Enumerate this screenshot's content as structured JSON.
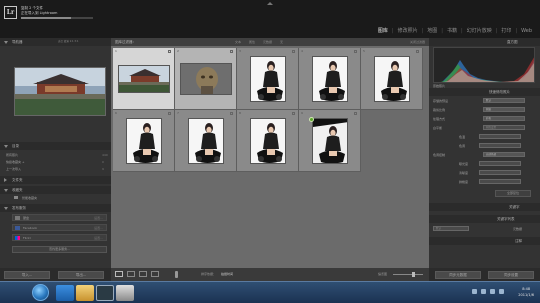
{
  "identity_plate": {
    "line1": "复制 2 个文件",
    "line2": "正在导入到 Lightroom",
    "logo": "Lr"
  },
  "import_progress": 0.7,
  "modules": [
    {
      "label": "图库",
      "active": true
    },
    {
      "label": "修改照片",
      "active": false
    },
    {
      "label": "地图",
      "active": false
    },
    {
      "label": "书籍",
      "active": false
    },
    {
      "label": "幻灯片放映",
      "active": false
    },
    {
      "label": "打印",
      "active": false
    },
    {
      "label": "Web",
      "active": false
    }
  ],
  "left_panel": {
    "navigator_header": "导航器",
    "navigator_zoom": "适合  填满  1:1  3:1",
    "catalog_header": "目录",
    "catalog_items": [
      {
        "label": "所有照片",
        "count": "440"
      },
      {
        "label": "快捷收藏夹 +",
        "count": "0"
      },
      {
        "label": "上一次导入",
        "count": "9"
      }
    ],
    "folders_header": "文件夹",
    "collections_header": "收藏夹",
    "collection_item": "智能收藏夹",
    "publish_header": "发布服务",
    "publish_items": [
      {
        "label": "硬盘",
        "action": "设置..."
      },
      {
        "label": "Facebook",
        "action": "设置..."
      },
      {
        "label": "Flickr",
        "action": "设置..."
      }
    ],
    "more_services": "查找更多服务...",
    "import_button": "导入...",
    "export_button": "导出..."
  },
  "grid_header": {
    "title": "图库过滤器：",
    "filters": [
      "文本",
      "属性",
      "元数据",
      "无"
    ],
    "right": "关闭过滤器"
  },
  "grid_cells": [
    {
      "num": "1",
      "kind": "landscape",
      "state": "selected"
    },
    {
      "num": "2",
      "kind": "statue",
      "state": "soft"
    },
    {
      "num": "3",
      "kind": "portrait",
      "state": "normal"
    },
    {
      "num": "4",
      "kind": "portrait",
      "state": "normal"
    },
    {
      "num": "5",
      "kind": "portrait",
      "state": "normal"
    },
    {
      "num": "6",
      "kind": "portrait",
      "state": "normal"
    },
    {
      "num": "7",
      "kind": "portrait",
      "state": "normal"
    },
    {
      "num": "8",
      "kind": "portrait",
      "state": "normal"
    },
    {
      "num": "9",
      "kind": "portrait-dark",
      "state": "normal"
    }
  ],
  "toolbar": {
    "sort_label": "排序依据：",
    "sort_value": "拍摄时间",
    "thumbs_label": "缩览图"
  },
  "right_panel": {
    "histogram_header": "直方图",
    "original_label": "原始照片",
    "quick_develop_header": "快速修改照片",
    "saved_preset_label": "存储的预设",
    "saved_preset_value": "默认",
    "crop_label": "裁剪比例",
    "crop_value": "原始",
    "treatment_label": "处理方式",
    "treatment_value": "彩色",
    "white_balance_label": "白平衡",
    "white_balance_value": "原照设置",
    "wb_temp_label": "色温",
    "wb_tint_label": "色调",
    "tone_label": "色调控制",
    "tone_value": "自动色调",
    "exposure_label": "曝光度",
    "clarity_label": "清晰度",
    "vibrance_label": "鲜艳度",
    "reset_button": "全部复位",
    "keywords_header": "关键字",
    "keyword_list_header": "关键字列表",
    "metadata_header": "元数据",
    "metadata_preset_label": "默认",
    "comments_header": "注释",
    "sync_meta_button": "同步元数据",
    "sync_settings_button": "同步设置"
  },
  "taskbar": {
    "time": "8:48",
    "date": "2011/1/6"
  }
}
